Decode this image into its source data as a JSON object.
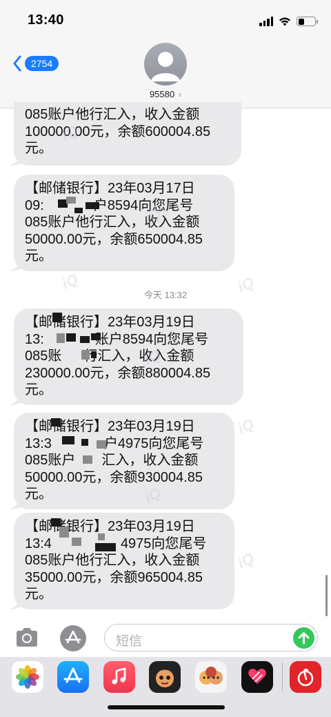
{
  "status": {
    "time": "13:40"
  },
  "nav": {
    "back_count": "2754",
    "contact_name": "95580",
    "contact_chevron": "›"
  },
  "messages": [
    {
      "lines": [
        "085账户他行汇入，收入金额",
        "100000.00元，余额600004.85",
        "元。"
      ]
    },
    {
      "lines": [
        "【邮储银行】23年03月17日",
        "09:",
        "085账户他行汇入，收入金额",
        "50000.00元，余额650004.85",
        "元。"
      ],
      "line2_tail": "户8594向您尾号"
    },
    {
      "lines": [
        "【邮储银行】23年03月19日",
        "13:",
        "085账",
        "230000.00元，余额880004.85",
        "元。"
      ],
      "line2_tail": "账户8594向您尾号",
      "line3_tail": "行汇入，收入金额"
    },
    {
      "lines": [
        "【邮储银行】23年03月19日",
        "13:3",
        "085账户",
        "50000.00元，余额930004.85",
        "元。"
      ],
      "line2_tail": "户4975向您尾号",
      "line3_tail": "汇入，收入金额"
    },
    {
      "lines": [
        "【邮储银行】23年03月19日",
        "13:4",
        "085账户他行汇入，收入金额",
        "35000.00元，余额965004.85",
        "元。"
      ],
      "line2_tail": "4975向您尾号"
    }
  ],
  "timestamp": "今天 13:32",
  "input": {
    "placeholder": "短信"
  },
  "icons": {
    "back": "chevron-left-icon",
    "camera": "camera-icon",
    "appstore": "app-store-icon",
    "send": "arrow-up-icon"
  },
  "colors": {
    "accent": "#1a7cff",
    "bubble": "#e9e9eb",
    "send": "#34c759"
  }
}
